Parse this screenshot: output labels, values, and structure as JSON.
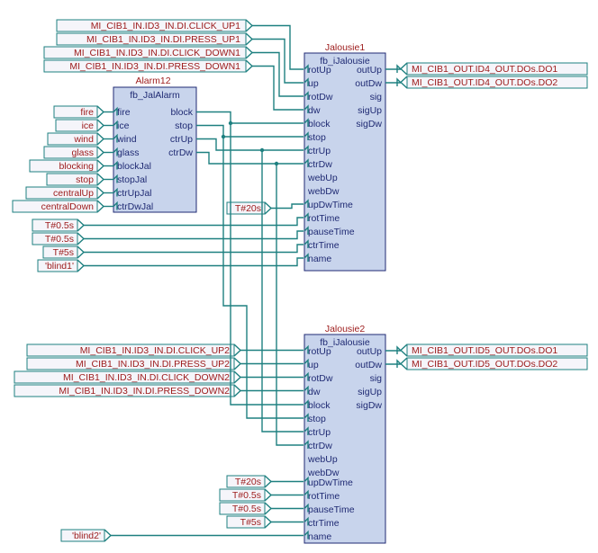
{
  "tags": {
    "click_up1": "MI_CIB1_IN.ID3_IN.DI.CLICK_UP1",
    "press_up1": "MI_CIB1_IN.ID3_IN.DI.PRESS_UP1",
    "click_down1": "MI_CIB1_IN.ID3_IN.DI.CLICK_DOWN1",
    "press_down1": "MI_CIB1_IN.ID3_IN.DI.PRESS_DOWN1",
    "fire": "fire",
    "ice": "ice",
    "wind": "wind",
    "glass": "glass",
    "blocking": "blocking",
    "stop": "stop",
    "centralUp": "centralUp",
    "centralDown": "centralDown",
    "t05a": "T#0.5s",
    "t05b": "T#0.5s",
    "t5": "T#5s",
    "blind1": "'blind1'",
    "t20": "T#20s",
    "t20b": "T#20s",
    "t05c": "T#0.5s",
    "t05d": "T#0.5s",
    "t5b": "T#5s",
    "blind2": "'blind2'",
    "click_up2": "MI_CIB1_IN.ID3_IN.DI.CLICK_UP2",
    "press_up2": "MI_CIB1_IN.ID3_IN.DI.PRESS_UP2",
    "click_down2": "MI_CIB1_IN.ID3_IN.DI.CLICK_DOWN2",
    "press_down2": "MI_CIB1_IN.ID3_IN.DI.PRESS_DOWN2",
    "out4_do1": "MI_CIB1_OUT.ID4_OUT.DOs.DO1",
    "out4_do2": "MI_CIB1_OUT.ID4_OUT.DOs.DO2",
    "out5_do1": "MI_CIB1_OUT.ID5_OUT.DOs.DO1",
    "out5_do2": "MI_CIB1_OUT.ID5_OUT.DOs.DO2"
  },
  "alarm": {
    "title": "Alarm12",
    "type": "fb_JalAlarm",
    "left": [
      "fire",
      "ice",
      "wind",
      "glass",
      "blockJal",
      "stopJal",
      "ctrUpJal",
      "ctrDwJal"
    ],
    "right": [
      "block",
      "stop",
      "ctrUp",
      "ctrDw"
    ]
  },
  "jal": {
    "title1": "Jalousie1",
    "title2": "Jalousie2",
    "type": "fb_iJalousie",
    "left": [
      "rotUp",
      "up",
      "rotDw",
      "dw",
      "block",
      "stop",
      "ctrUp",
      "ctrDw",
      "webUp",
      "webDw",
      "upDwTime",
      "rotTime",
      "pauseTime",
      "ctrTime",
      "name"
    ],
    "right": [
      "outUp",
      "outDw",
      "sig",
      "sigUp",
      "sigDw"
    ]
  }
}
